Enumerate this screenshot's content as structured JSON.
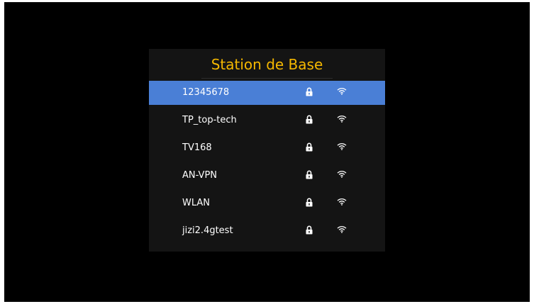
{
  "dialog": {
    "title": "Station de Base"
  },
  "colors": {
    "title": "#f5b800",
    "selected_row": "#4a7fd6",
    "dialog_bg": "#141414",
    "screen_bg": "#000000"
  },
  "networks": [
    {
      "name": "12345678",
      "secured": true,
      "icon": "lock-icon",
      "signal_icon": "wifi-signal-icon",
      "selected": true
    },
    {
      "name": "TP_top-tech",
      "secured": true,
      "icon": "lock-icon",
      "signal_icon": "wifi-signal-icon",
      "selected": false
    },
    {
      "name": "TV168",
      "secured": true,
      "icon": "lock-icon",
      "signal_icon": "wifi-signal-icon",
      "selected": false
    },
    {
      "name": "AN-VPN",
      "secured": true,
      "icon": "lock-icon",
      "signal_icon": "wifi-signal-icon",
      "selected": false
    },
    {
      "name": "WLAN",
      "secured": true,
      "icon": "lock-icon",
      "signal_icon": "wifi-signal-icon",
      "selected": false
    },
    {
      "name": "jizi2.4gtest",
      "secured": true,
      "icon": "lock-icon",
      "signal_icon": "wifi-signal-icon",
      "selected": false
    }
  ]
}
